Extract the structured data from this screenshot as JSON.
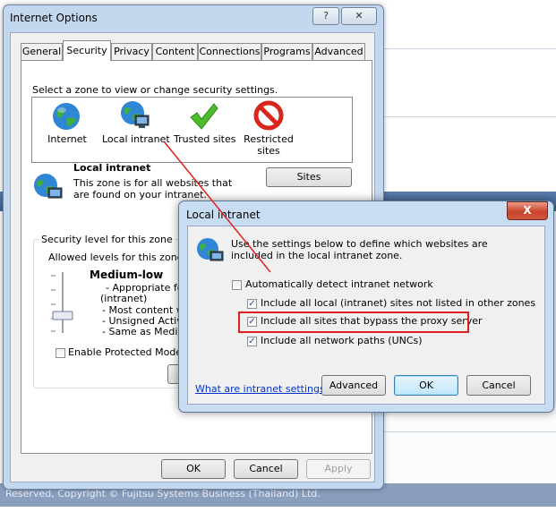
{
  "background_page": {
    "footer_text": "Reserved, Copyright © Fujitsu Systems Business (Thailand) Ltd."
  },
  "internet_options": {
    "title": "Internet Options",
    "help_button": "?",
    "close_button": "✕",
    "tabs": [
      "General",
      "Security",
      "Privacy",
      "Content",
      "Connections",
      "Programs",
      "Advanced"
    ],
    "active_tab": "Security",
    "zone_prompt": "Select a zone to view or change security settings.",
    "zones": [
      {
        "label": "Internet",
        "icon": "globe-icon"
      },
      {
        "label": "Local intranet",
        "icon": "intranet-globe-icon"
      },
      {
        "label": "Trusted sites",
        "icon": "checkmark-icon"
      },
      {
        "label": "Restricted sites",
        "icon": "prohibited-icon"
      }
    ],
    "zone_heading": "Local intranet",
    "zone_description": "This zone is for all websites that are found on your intranet.",
    "sites_button": "Sites",
    "security_group_label": "Security level for this zone",
    "allowed_levels": "Allowed levels for this zone: A",
    "level_name": "Medium-low",
    "level_bullets": [
      "- Appropriate for w",
      "(intranet)",
      "- Most content will",
      "- Unsigned ActiveX",
      "- Same as Medium"
    ],
    "slider_level": "Medium-low",
    "protected_mode_label": "Enable Protected Mode (r",
    "protected_mode_checked": false,
    "ok_button": "OK",
    "cancel_button": "Cancel",
    "apply_button": "Apply"
  },
  "local_intranet_dialog": {
    "title": "Local intranet",
    "close_button": "X",
    "description": "Use the settings below to define which websites are included in the local intranet zone.",
    "options": [
      {
        "label": "Automatically detect intranet network",
        "checked": false
      },
      {
        "label": "Include all local (intranet) sites not listed in other zones",
        "checked": true
      },
      {
        "label": "Include all sites that bypass the proxy server",
        "checked": true
      },
      {
        "label": "Include all network paths (UNCs)",
        "checked": true
      }
    ],
    "help_link": "What are intranet settings?",
    "advanced_button": "Advanced",
    "ok_button": "OK",
    "cancel_button": "Cancel"
  },
  "colors": {
    "highlight_box": "#e02020",
    "annotation_line": "#e02020",
    "window_frame": "#c3d7ef"
  }
}
